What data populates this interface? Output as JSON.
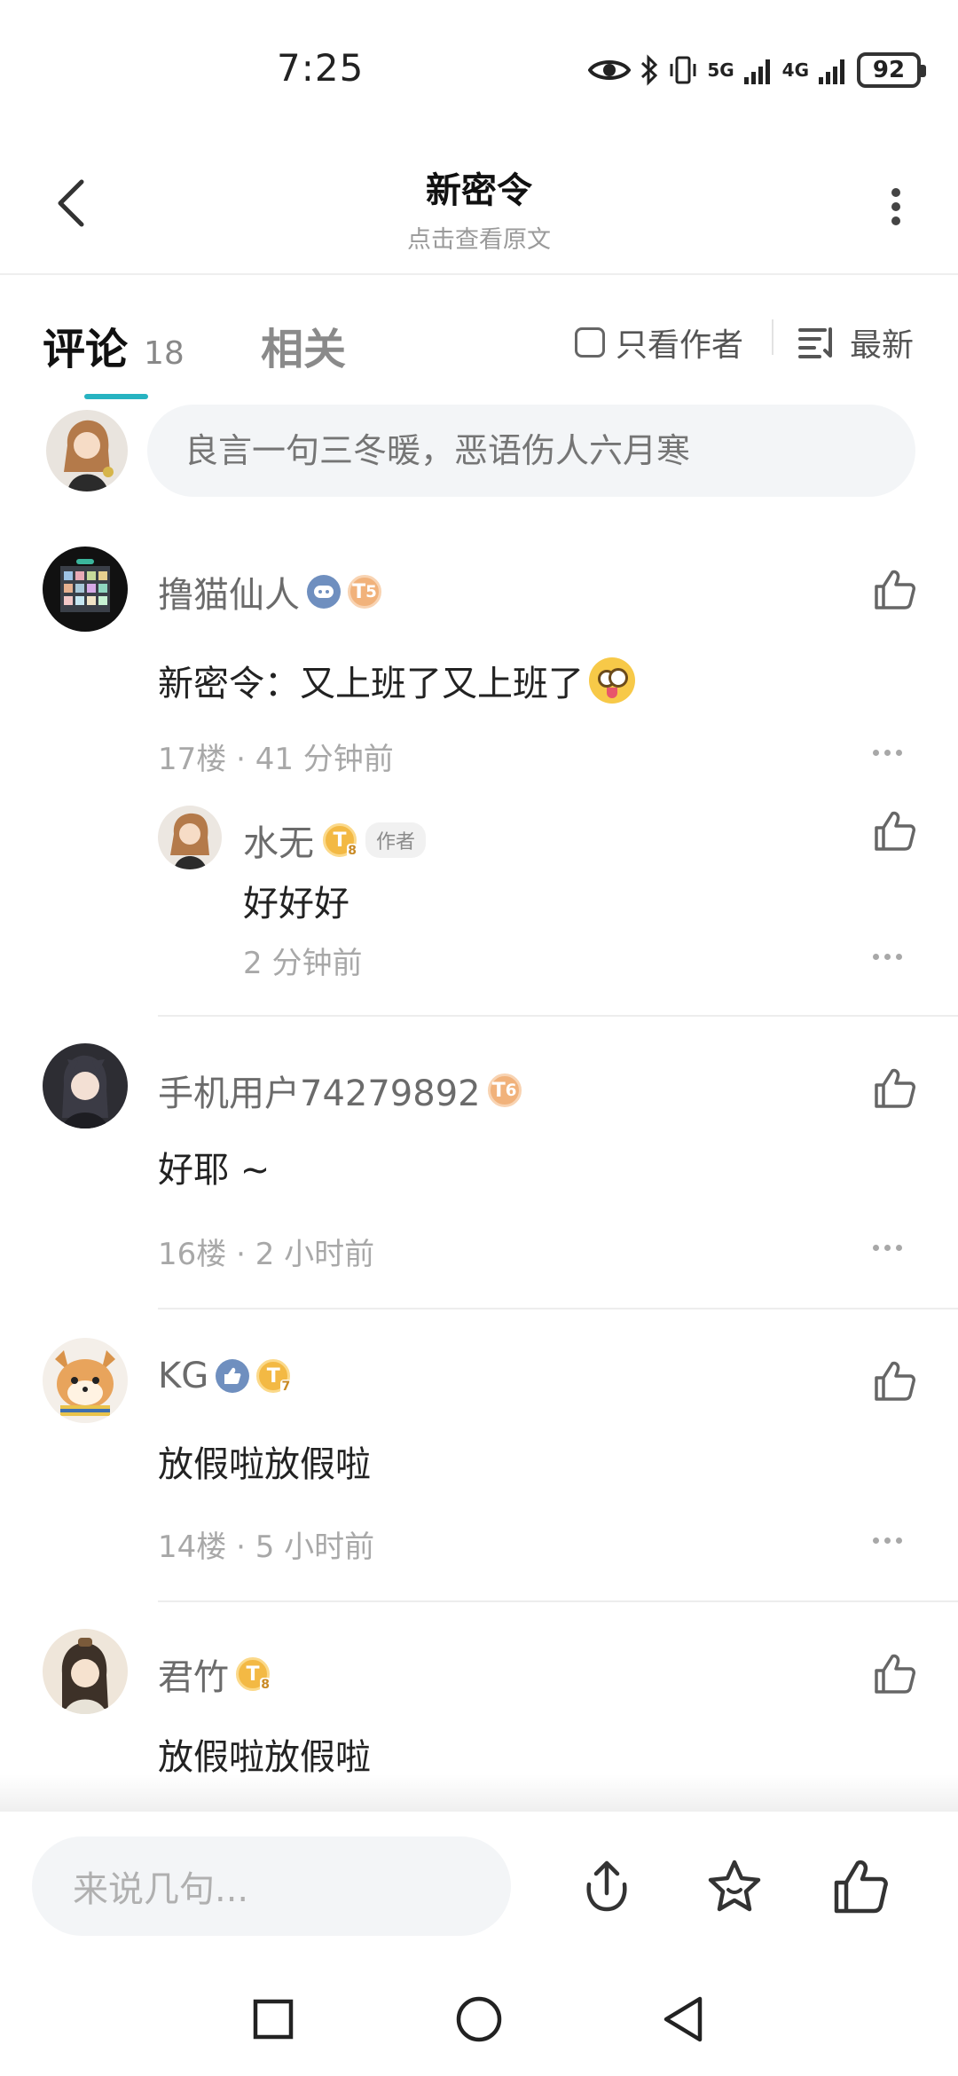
{
  "status_bar": {
    "time": "7:25",
    "network1": "5G",
    "network2": "4G",
    "battery": "92",
    "icons": [
      "eye-icon",
      "bluetooth-icon",
      "vibrate-icon",
      "signal-icon",
      "signal-icon",
      "battery-icon"
    ]
  },
  "header": {
    "title": "新密令",
    "subtitle": "点击查看原文"
  },
  "tabs": {
    "comments_label": "评论",
    "comments_count": "18",
    "related_label": "相关",
    "author_only_label": "只看作者",
    "sort_label": "最新"
  },
  "comment_input": {
    "placeholder": "良言一句三冬暖，恶语伤人六月寒"
  },
  "comments": [
    {
      "username": "撸猫仙人",
      "level": "5",
      "content": "新密令：又上班了又上班了",
      "floor": "17楼",
      "time": "41 分钟前",
      "reply": {
        "username": "水无",
        "level": "8",
        "tag": "作者",
        "content": "好好好",
        "time": "2 分钟前"
      }
    },
    {
      "username": "手机用户74279892",
      "level": "6",
      "content": "好耶 ~",
      "floor": "16楼",
      "time": "2 小时前"
    },
    {
      "username": "KG",
      "level": "7",
      "content": "放假啦放假啦",
      "floor": "14楼",
      "time": "5 小时前"
    },
    {
      "username": "君竹",
      "level": "8",
      "content": "放假啦放假啦"
    }
  ],
  "meta_separator": "·",
  "badge_letter": "T",
  "bottom_bar": {
    "placeholder": "来说几句..."
  },
  "colors": {
    "accent": "#27b3c1",
    "badge_gold": "#f3b944",
    "badge_orange": "#f1b27b",
    "badge_blue": "#6f8fbf"
  }
}
